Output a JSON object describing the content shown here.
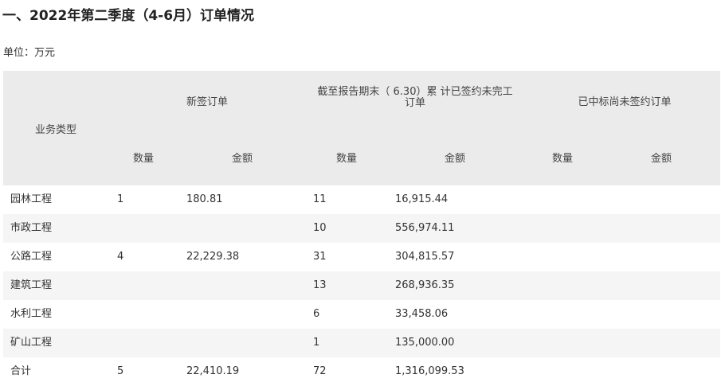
{
  "heading": "一、2022年第二季度（4-6月）订单情况",
  "unit_label": "单位：万元",
  "table": {
    "header": {
      "business_type": "业务类型",
      "new_orders": "新签订单",
      "backlog_line1": "截至报告期末（ 6.30）累 计已签约未完工",
      "backlog_line2": "订单",
      "won_unsigned": "已中标尚未签约订单",
      "quantity": "数量",
      "amount": "金额"
    },
    "rows": [
      {
        "type": "园林工程",
        "new_qty": "1",
        "new_amt": "180.81",
        "backlog_qty": "11",
        "backlog_amt": "16,915.44",
        "won_qty": "",
        "won_amt": ""
      },
      {
        "type": "市政工程",
        "new_qty": "",
        "new_amt": "",
        "backlog_qty": "10",
        "backlog_amt": "556,974.11",
        "won_qty": "",
        "won_amt": ""
      },
      {
        "type": "公路工程",
        "new_qty": "4",
        "new_amt": "22,229.38",
        "backlog_qty": "31",
        "backlog_amt": "304,815.57",
        "won_qty": "",
        "won_amt": ""
      },
      {
        "type": "建筑工程",
        "new_qty": "",
        "new_amt": "",
        "backlog_qty": "13",
        "backlog_amt": "268,936.35",
        "won_qty": "",
        "won_amt": ""
      },
      {
        "type": "水利工程",
        "new_qty": "",
        "new_amt": "",
        "backlog_qty": "6",
        "backlog_amt": "33,458.06",
        "won_qty": "",
        "won_amt": ""
      },
      {
        "type": "矿山工程",
        "new_qty": "",
        "new_amt": "",
        "backlog_qty": "1",
        "backlog_amt": "135,000.00",
        "won_qty": "",
        "won_amt": ""
      },
      {
        "type": "合计",
        "new_qty": "5",
        "new_amt": "22,410.19",
        "backlog_qty": "72",
        "backlog_amt": "1,316,099.53",
        "won_qty": "",
        "won_amt": ""
      }
    ]
  }
}
